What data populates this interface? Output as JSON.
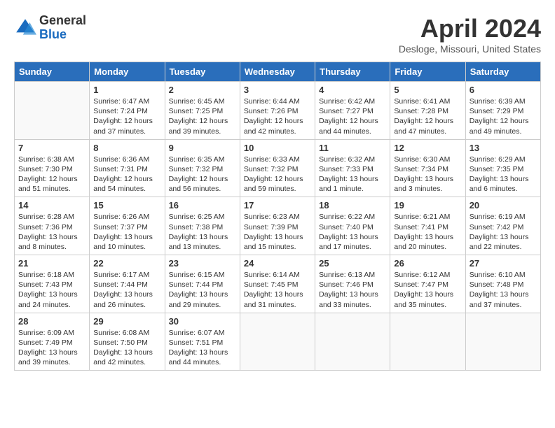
{
  "header": {
    "logo_general": "General",
    "logo_blue": "Blue",
    "month_title": "April 2024",
    "location": "Desloge, Missouri, United States"
  },
  "days_of_week": [
    "Sunday",
    "Monday",
    "Tuesday",
    "Wednesday",
    "Thursday",
    "Friday",
    "Saturday"
  ],
  "weeks": [
    [
      {
        "day": "",
        "sunrise": "",
        "sunset": "",
        "daylight": "",
        "empty": true
      },
      {
        "day": "1",
        "sunrise": "Sunrise: 6:47 AM",
        "sunset": "Sunset: 7:24 PM",
        "daylight": "Daylight: 12 hours and 37 minutes.",
        "empty": false
      },
      {
        "day": "2",
        "sunrise": "Sunrise: 6:45 AM",
        "sunset": "Sunset: 7:25 PM",
        "daylight": "Daylight: 12 hours and 39 minutes.",
        "empty": false
      },
      {
        "day": "3",
        "sunrise": "Sunrise: 6:44 AM",
        "sunset": "Sunset: 7:26 PM",
        "daylight": "Daylight: 12 hours and 42 minutes.",
        "empty": false
      },
      {
        "day": "4",
        "sunrise": "Sunrise: 6:42 AM",
        "sunset": "Sunset: 7:27 PM",
        "daylight": "Daylight: 12 hours and 44 minutes.",
        "empty": false
      },
      {
        "day": "5",
        "sunrise": "Sunrise: 6:41 AM",
        "sunset": "Sunset: 7:28 PM",
        "daylight": "Daylight: 12 hours and 47 minutes.",
        "empty": false
      },
      {
        "day": "6",
        "sunrise": "Sunrise: 6:39 AM",
        "sunset": "Sunset: 7:29 PM",
        "daylight": "Daylight: 12 hours and 49 minutes.",
        "empty": false
      }
    ],
    [
      {
        "day": "7",
        "sunrise": "Sunrise: 6:38 AM",
        "sunset": "Sunset: 7:30 PM",
        "daylight": "Daylight: 12 hours and 51 minutes.",
        "empty": false
      },
      {
        "day": "8",
        "sunrise": "Sunrise: 6:36 AM",
        "sunset": "Sunset: 7:31 PM",
        "daylight": "Daylight: 12 hours and 54 minutes.",
        "empty": false
      },
      {
        "day": "9",
        "sunrise": "Sunrise: 6:35 AM",
        "sunset": "Sunset: 7:32 PM",
        "daylight": "Daylight: 12 hours and 56 minutes.",
        "empty": false
      },
      {
        "day": "10",
        "sunrise": "Sunrise: 6:33 AM",
        "sunset": "Sunset: 7:32 PM",
        "daylight": "Daylight: 12 hours and 59 minutes.",
        "empty": false
      },
      {
        "day": "11",
        "sunrise": "Sunrise: 6:32 AM",
        "sunset": "Sunset: 7:33 PM",
        "daylight": "Daylight: 13 hours and 1 minute.",
        "empty": false
      },
      {
        "day": "12",
        "sunrise": "Sunrise: 6:30 AM",
        "sunset": "Sunset: 7:34 PM",
        "daylight": "Daylight: 13 hours and 3 minutes.",
        "empty": false
      },
      {
        "day": "13",
        "sunrise": "Sunrise: 6:29 AM",
        "sunset": "Sunset: 7:35 PM",
        "daylight": "Daylight: 13 hours and 6 minutes.",
        "empty": false
      }
    ],
    [
      {
        "day": "14",
        "sunrise": "Sunrise: 6:28 AM",
        "sunset": "Sunset: 7:36 PM",
        "daylight": "Daylight: 13 hours and 8 minutes.",
        "empty": false
      },
      {
        "day": "15",
        "sunrise": "Sunrise: 6:26 AM",
        "sunset": "Sunset: 7:37 PM",
        "daylight": "Daylight: 13 hours and 10 minutes.",
        "empty": false
      },
      {
        "day": "16",
        "sunrise": "Sunrise: 6:25 AM",
        "sunset": "Sunset: 7:38 PM",
        "daylight": "Daylight: 13 hours and 13 minutes.",
        "empty": false
      },
      {
        "day": "17",
        "sunrise": "Sunrise: 6:23 AM",
        "sunset": "Sunset: 7:39 PM",
        "daylight": "Daylight: 13 hours and 15 minutes.",
        "empty": false
      },
      {
        "day": "18",
        "sunrise": "Sunrise: 6:22 AM",
        "sunset": "Sunset: 7:40 PM",
        "daylight": "Daylight: 13 hours and 17 minutes.",
        "empty": false
      },
      {
        "day": "19",
        "sunrise": "Sunrise: 6:21 AM",
        "sunset": "Sunset: 7:41 PM",
        "daylight": "Daylight: 13 hours and 20 minutes.",
        "empty": false
      },
      {
        "day": "20",
        "sunrise": "Sunrise: 6:19 AM",
        "sunset": "Sunset: 7:42 PM",
        "daylight": "Daylight: 13 hours and 22 minutes.",
        "empty": false
      }
    ],
    [
      {
        "day": "21",
        "sunrise": "Sunrise: 6:18 AM",
        "sunset": "Sunset: 7:43 PM",
        "daylight": "Daylight: 13 hours and 24 minutes.",
        "empty": false
      },
      {
        "day": "22",
        "sunrise": "Sunrise: 6:17 AM",
        "sunset": "Sunset: 7:44 PM",
        "daylight": "Daylight: 13 hours and 26 minutes.",
        "empty": false
      },
      {
        "day": "23",
        "sunrise": "Sunrise: 6:15 AM",
        "sunset": "Sunset: 7:44 PM",
        "daylight": "Daylight: 13 hours and 29 minutes.",
        "empty": false
      },
      {
        "day": "24",
        "sunrise": "Sunrise: 6:14 AM",
        "sunset": "Sunset: 7:45 PM",
        "daylight": "Daylight: 13 hours and 31 minutes.",
        "empty": false
      },
      {
        "day": "25",
        "sunrise": "Sunrise: 6:13 AM",
        "sunset": "Sunset: 7:46 PM",
        "daylight": "Daylight: 13 hours and 33 minutes.",
        "empty": false
      },
      {
        "day": "26",
        "sunrise": "Sunrise: 6:12 AM",
        "sunset": "Sunset: 7:47 PM",
        "daylight": "Daylight: 13 hours and 35 minutes.",
        "empty": false
      },
      {
        "day": "27",
        "sunrise": "Sunrise: 6:10 AM",
        "sunset": "Sunset: 7:48 PM",
        "daylight": "Daylight: 13 hours and 37 minutes.",
        "empty": false
      }
    ],
    [
      {
        "day": "28",
        "sunrise": "Sunrise: 6:09 AM",
        "sunset": "Sunset: 7:49 PM",
        "daylight": "Daylight: 13 hours and 39 minutes.",
        "empty": false
      },
      {
        "day": "29",
        "sunrise": "Sunrise: 6:08 AM",
        "sunset": "Sunset: 7:50 PM",
        "daylight": "Daylight: 13 hours and 42 minutes.",
        "empty": false
      },
      {
        "day": "30",
        "sunrise": "Sunrise: 6:07 AM",
        "sunset": "Sunset: 7:51 PM",
        "daylight": "Daylight: 13 hours and 44 minutes.",
        "empty": false
      },
      {
        "day": "",
        "sunrise": "",
        "sunset": "",
        "daylight": "",
        "empty": true
      },
      {
        "day": "",
        "sunrise": "",
        "sunset": "",
        "daylight": "",
        "empty": true
      },
      {
        "day": "",
        "sunrise": "",
        "sunset": "",
        "daylight": "",
        "empty": true
      },
      {
        "day": "",
        "sunrise": "",
        "sunset": "",
        "daylight": "",
        "empty": true
      }
    ]
  ]
}
